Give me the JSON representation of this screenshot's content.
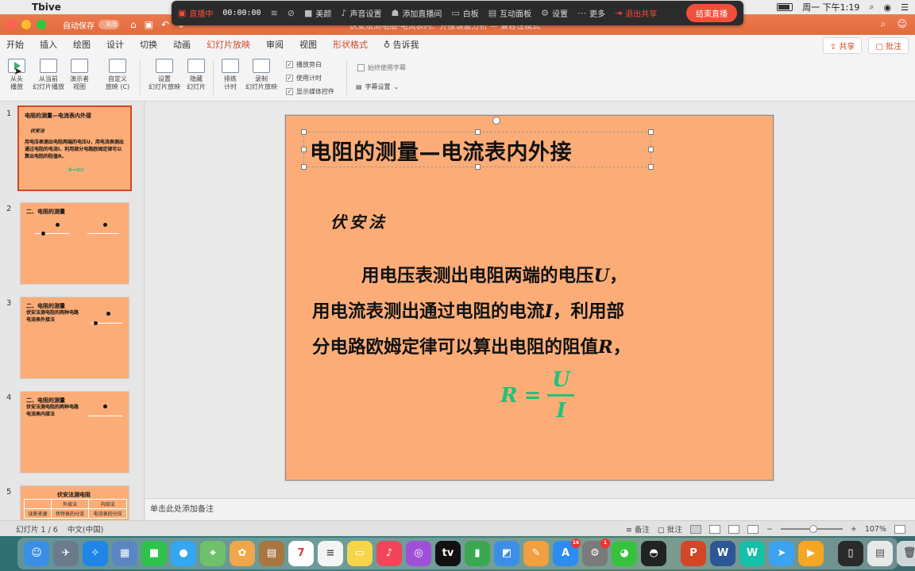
{
  "menubar": {
    "app_name": "Tbive",
    "clock": "周一 下午1:19"
  },
  "live": {
    "status": "直播中",
    "timer": "00:00:00",
    "items": [
      "美颜",
      "声音设置",
      "添加直播间",
      "白板",
      "互动面板",
      "设置",
      "更多"
    ],
    "exit_share": "退出共享",
    "end_live": "结束直播"
  },
  "window": {
    "autosave_label": "自动保存",
    "autosave_state": "关闭",
    "doc_title": "伏安法测电阻-电流表内、外接误差分析 — 兼容性模式"
  },
  "tabs": [
    "开始",
    "插入",
    "绘图",
    "设计",
    "切换",
    "动画",
    "幻灯片放映",
    "审阅",
    "视图",
    "形状格式",
    "告诉我"
  ],
  "share": {
    "share_label": "共享",
    "comment_label": "批注"
  },
  "ribbon": {
    "from_start": "从头\n播放",
    "from_current": "从当前\n幻灯片播放",
    "presenter": "演示者\n视图",
    "custom_show": "自定义\n放映 (C)",
    "setup_show": "设置\n幻灯片放映",
    "hide_slide": "隐藏\n幻灯片",
    "rehearse": "排练\n计时",
    "record": "录制\n幻灯片放映",
    "play_narrations": "播放旁白",
    "use_timings": "使用计时",
    "show_media_controls": "显示媒体控件",
    "always_subtitles": "始终使用字幕",
    "subtitle_settings": "字幕设置"
  },
  "thumbnails": [
    {
      "num": "1",
      "title": "电阻的测量—电流表内外接",
      "sub": "伏安法",
      "text": "用电压表测出电阻两端的电压U，用电流表测出通过电阻的电流I，利用部分电路欧姆定律可以算出电阻的阻值R。"
    },
    {
      "num": "2",
      "title": "二、电阻的测量"
    },
    {
      "num": "3",
      "title": "二、电阻的测量",
      "sub1": "伏安法测电阻的两种电路",
      "sub2": "电流表外接法"
    },
    {
      "num": "4",
      "title": "二、电阻的测量",
      "sub1": "伏安法测电阻的两种电路",
      "sub2": "电流表内接法"
    },
    {
      "num": "5",
      "title": "伏安法测电阻",
      "row1": [
        "",
        "外接法",
        "内接法"
      ],
      "row2": [
        "误差来源",
        "伏特表的分流",
        "电流表的分压"
      ]
    }
  ],
  "slide": {
    "title": "电阻的测量—电流表内外接",
    "subtitle": "伏安法",
    "line1": "用电压表测出电阻两端的电压",
    "line1_var": "U",
    "line2": "用电流表测出通过电阻的电流",
    "line2_var": "I",
    "line2_tail": "，利用部",
    "line3": "分电路欧姆定律可以算出电阻的阻值",
    "line3_var": "R",
    "comma": "，",
    "formula_lhs": "R",
    "formula_eq": "=",
    "formula_num": "U",
    "formula_den": "I",
    "formula_color": "#1ec37a",
    "background": "#fcad77"
  },
  "notes": {
    "placeholder": "单击此处添加备注"
  },
  "statusbar": {
    "slide_indicator": "幻灯片 1 / 6",
    "language": "中文(中国)",
    "notes_label": "备注",
    "comments_label": "批注",
    "zoom": "107%"
  },
  "dock": {
    "badge_appstore": "16",
    "badge_prefs": "1",
    "calendar_day": "7"
  },
  "colors": {
    "accent": "#d24726",
    "title_bar": "#e8744a"
  }
}
